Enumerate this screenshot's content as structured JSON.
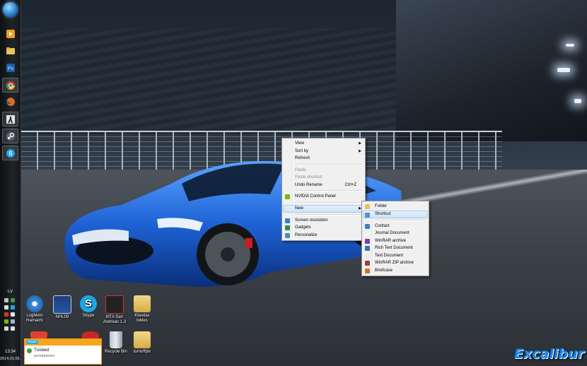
{
  "taskbar": {
    "pinned": [
      {
        "name": "start-orb-icon"
      },
      {
        "name": "media-player-icon",
        "color": "#f39c1f"
      },
      {
        "name": "folder-explorer-icon",
        "color": "#e8c25a"
      },
      {
        "name": "photoshop-icon",
        "color": "#1b5ea9"
      },
      {
        "name": "chrome-icon",
        "color": "#d93b2f"
      },
      {
        "name": "firefox-icon",
        "color": "#e46a16"
      },
      {
        "name": "counter-strike-icon",
        "color": "#dcdcdc"
      },
      {
        "name": "steam-icon",
        "color": "#5a6270"
      },
      {
        "name": "skype-icon",
        "color": "#1ba7e8"
      }
    ],
    "tray": {
      "language": "LV",
      "time": "13:34",
      "date": "2014.01.06."
    }
  },
  "desktop_icons": [
    {
      "id": "logmein",
      "label": "LogMeIn Hamachi",
      "icon": "hamachi-icon",
      "color": "#3d8fd8"
    },
    {
      "id": "nhl09",
      "label": "NHL09",
      "icon": "nhl09-icon",
      "color": "#2255a5"
    },
    {
      "id": "skype",
      "label": "Skype",
      "icon": "skype-icon",
      "color": "#1ba7e8"
    },
    {
      "id": "mta",
      "label": "MTA San Andreas 1.3",
      "icon": "mta-icon",
      "color": "#222222"
    },
    {
      "id": "klasdas",
      "label": "Klasdas bildes",
      "icon": "folder-icon",
      "color": "#e2c264"
    },
    {
      "id": "recycle",
      "label": "Recycle Bin",
      "icon": "recycle-bin-icon",
      "color": "#9aa6b2"
    },
    {
      "id": "turnoffpix",
      "label": "turnoffpix",
      "icon": "folder-icon",
      "color": "#e2c264"
    }
  ],
  "context_menu": {
    "items": [
      {
        "label": "View",
        "submenu": true
      },
      {
        "label": "Sort by",
        "submenu": true
      },
      {
        "label": "Refresh"
      },
      {
        "sep": true
      },
      {
        "label": "Paste",
        "disabled": true
      },
      {
        "label": "Paste shortcut",
        "disabled": true
      },
      {
        "label": "Undo Rename",
        "accel": "Ctrl+Z"
      },
      {
        "sep": true
      },
      {
        "label": "NVIDIA Control Panel",
        "icon": "nvidia-icon",
        "iconColor": "#76b900"
      },
      {
        "sep": true
      },
      {
        "label": "New",
        "submenu": true,
        "highlighted": true
      },
      {
        "sep": true
      },
      {
        "label": "Screen resolution",
        "icon": "display-icon",
        "iconColor": "#3a7fcb"
      },
      {
        "label": "Gadgets",
        "icon": "gadgets-icon",
        "iconColor": "#2f8f3e"
      },
      {
        "label": "Personalize",
        "icon": "personalize-icon",
        "iconColor": "#4f88c9"
      }
    ]
  },
  "new_submenu": {
    "items": [
      {
        "label": "Folder",
        "icon": "folder-icon",
        "iconColor": "#e8c25a"
      },
      {
        "label": "Shortcut",
        "icon": "shortcut-icon",
        "iconColor": "#5b8fcf",
        "highlighted": true
      },
      {
        "sep": true
      },
      {
        "label": "Contact",
        "icon": "contact-icon",
        "iconColor": "#3f7ec9"
      },
      {
        "label": "Journal Document",
        "icon": "journal-icon",
        "iconColor": "#f2f2f2"
      },
      {
        "label": "WinRAR archive",
        "icon": "winrar-icon",
        "iconColor": "#7a3f9b"
      },
      {
        "label": "Rich Text Document",
        "icon": "rich-text-icon",
        "iconColor": "#3470c2"
      },
      {
        "label": "Text Document",
        "icon": "text-document-icon",
        "iconColor": "#e9e9e9"
      },
      {
        "label": "WinRAR ZIP archive",
        "icon": "winrar-zip-icon",
        "iconColor": "#9b3f3f"
      },
      {
        "label": "Briefcase",
        "icon": "briefcase-icon",
        "iconColor": "#c9772b"
      }
    ]
  },
  "skype_notification": {
    "app": "skype",
    "title": "Tvisted",
    "message": "prestiedzies"
  },
  "brand": "Excalibur",
  "colors": {
    "car": "#1e62d6",
    "taskbar": "#1a1e23",
    "menu_bg": "#f0f0f0",
    "highlight": "#cde3f7",
    "notify_orange": "#f7a51c",
    "brand": "#1f86e8"
  }
}
